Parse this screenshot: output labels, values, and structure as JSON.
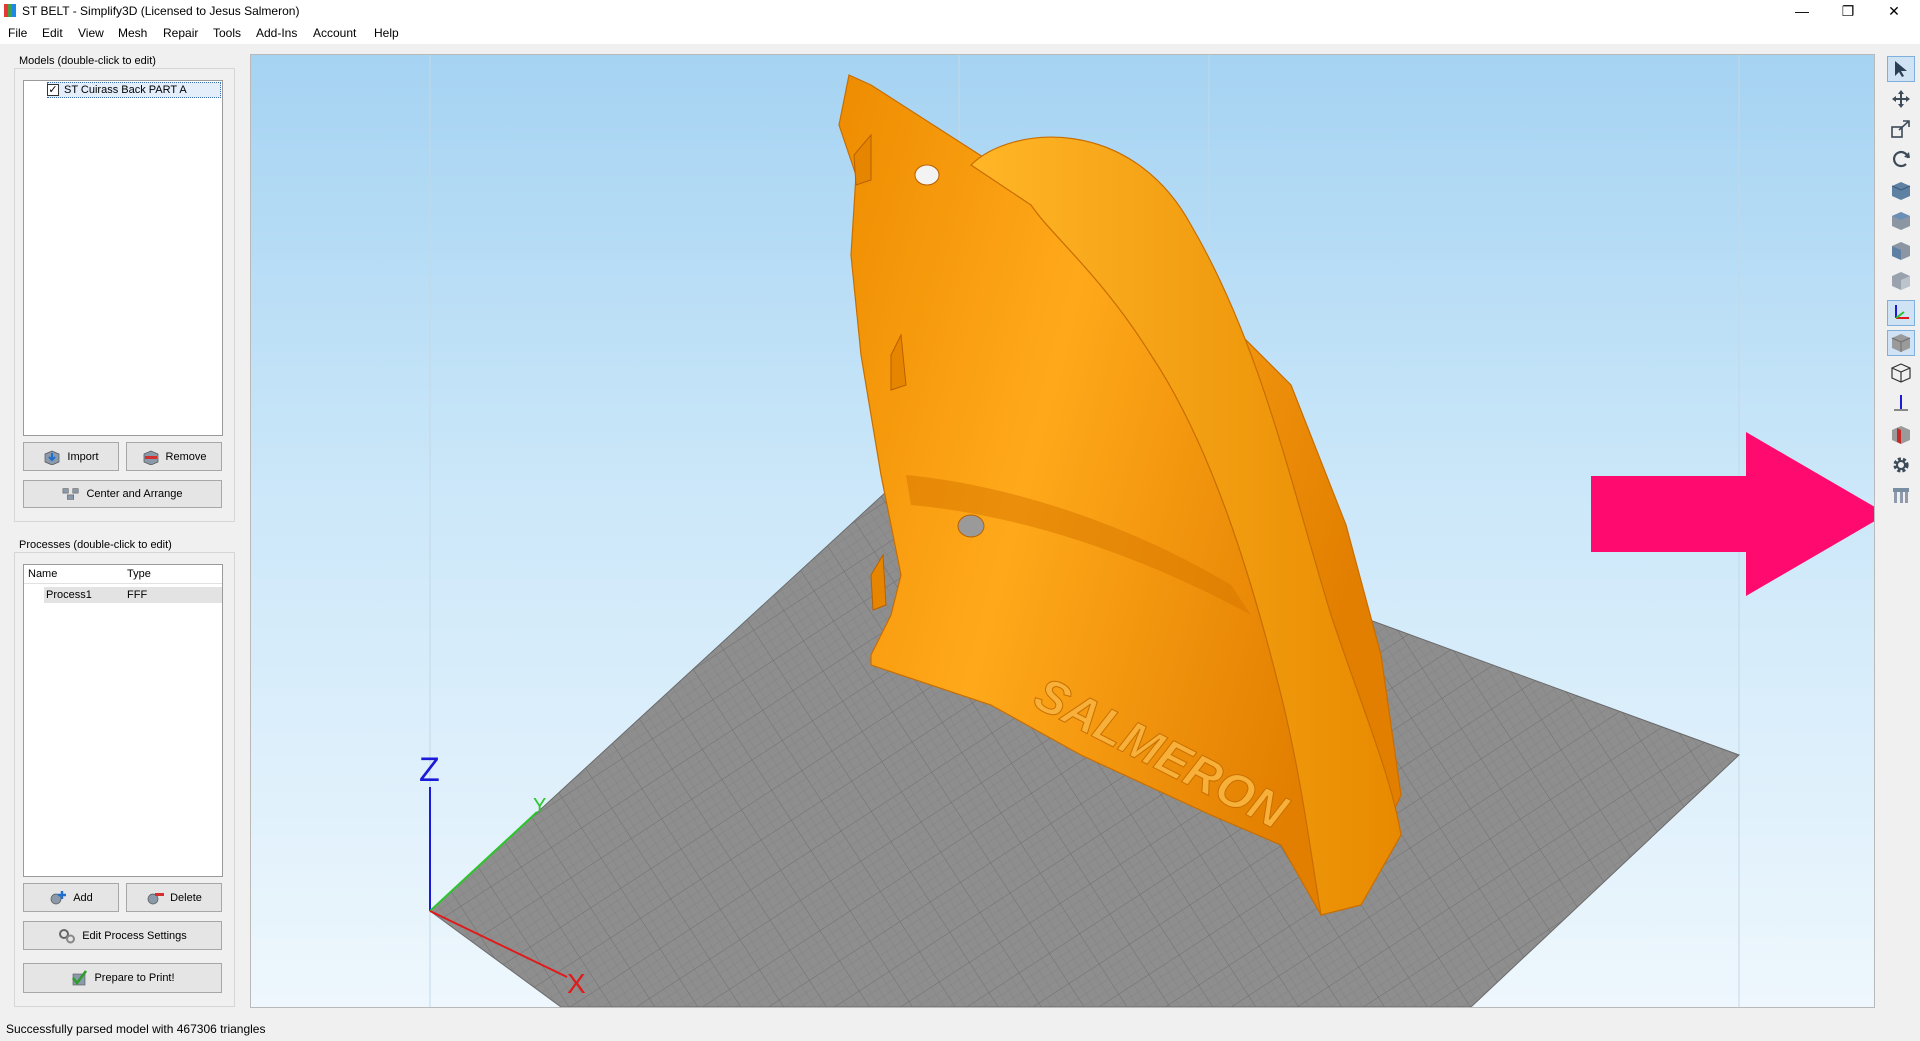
{
  "window": {
    "title": "ST BELT - Simplify3D (Licensed to Jesus Salmeron)",
    "controls": {
      "minimize": "—",
      "restore": "❐",
      "close": "✕"
    }
  },
  "menu": [
    "File",
    "Edit",
    "View",
    "Mesh",
    "Repair",
    "Tools",
    "Add-Ins",
    "Account",
    "Help"
  ],
  "models": {
    "group_label": "Models (double-click to edit)",
    "items": [
      {
        "name": "ST Cuirass Back PART A",
        "checked": true
      }
    ],
    "import_label": "Import",
    "remove_label": "Remove",
    "center_label": "Center and Arrange"
  },
  "processes": {
    "group_label": "Processes (double-click to edit)",
    "columns": [
      "Name",
      "Type"
    ],
    "rows": [
      {
        "name": "Process1",
        "type": "FFF"
      }
    ],
    "add_label": "Add",
    "delete_label": "Delete",
    "edit_label": "Edit Process Settings",
    "prepare_label": "Prepare to Print!"
  },
  "viewport": {
    "model_text": "SALMERON",
    "axis_labels": {
      "z": "Z",
      "x": "X",
      "y": "Y"
    },
    "colors": {
      "model": "#f5a00a",
      "bed": "#8e8e8e",
      "arrow": "#ff0a6e"
    }
  },
  "right_toolbar": [
    "select-icon",
    "move-icon",
    "scale-icon",
    "rotate-icon",
    "view-default-icon",
    "view-top-icon",
    "view-front-icon",
    "view-side-icon",
    "axes-icon",
    "solid-view-icon",
    "wireframe-icon",
    "normals-icon",
    "cross-section-icon",
    "settings-gear-icon",
    "support-icon"
  ],
  "status": "Successfully parsed model with 467306 triangles"
}
